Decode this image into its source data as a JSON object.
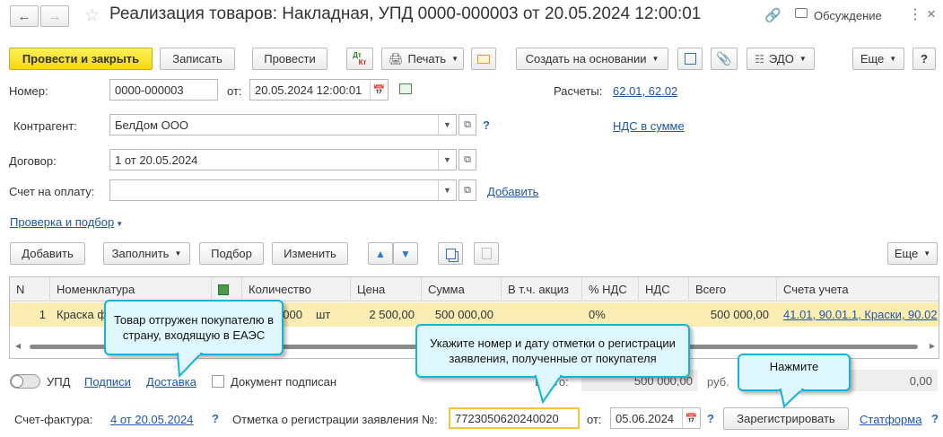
{
  "window": {
    "title": "Реализация товаров: Накладная, УПД 0000-000003 от 20.05.2024 12:00:01",
    "discussion": "Обсуждение"
  },
  "toolbar": {
    "post_close": "Провести и закрыть",
    "save": "Записать",
    "post": "Провести",
    "dtkt_top": "Дт",
    "dtkt_bottom": "Кт",
    "print": "Печать",
    "create_based": "Создать на основании",
    "edo": "ЭДО",
    "more": "Еще",
    "help": "?"
  },
  "header": {
    "number_label": "Номер:",
    "number_value": "0000-000003",
    "from_label": "от:",
    "date_value": "20.05.2024 12:00:01",
    "accounts_label": "Расчеты:",
    "accounts_value": "62.01, 62.02",
    "counterparty_label": "Контрагент:",
    "counterparty_value": "БелДом ООО",
    "vat_link": "НДС в сумме",
    "contract_label": "Договор:",
    "contract_value": "1 от 20.05.2024",
    "invoice_label": "Счет на оплату:",
    "invoice_value": "",
    "add_link": "Добавить",
    "check_link": "Проверка и подбор",
    "q": "?"
  },
  "table_toolbar": {
    "add": "Добавить",
    "fill": "Заполнить",
    "select": "Подбор",
    "change": "Изменить",
    "more": "Еще"
  },
  "table": {
    "headers": [
      "N",
      "Номенклатура",
      "Количество",
      "Цена",
      "Сумма",
      "В т.ч. акциз",
      "% НДС",
      "НДС",
      "Всего",
      "Счета учета"
    ],
    "row": {
      "n": "1",
      "item": "Краска ф",
      "qty": "000",
      "unit": "шт",
      "price": "2 500,00",
      "sum": "500 000,00",
      "excise": "",
      "vat_rate": "0%",
      "vat": "",
      "total": "500 000,00",
      "accounts": "41.01, 90.01.1, Краски, 90.02"
    }
  },
  "footer": {
    "upd": "УПД",
    "signatures": "Подписи",
    "delivery": "Доставка",
    "signed": "Документ подписан",
    "total_label": "Всего:",
    "total_value": "500 000,00",
    "currency": "руб.",
    "vat_value": "0,00",
    "invoice_label": "Счет-фактура:",
    "invoice_link": "4 от 20.05.2024",
    "reg_label": "Отметка о регистрации заявления №:",
    "reg_value": "7723050620240020",
    "reg_from": "от:",
    "reg_date": "05.06.2024",
    "register_btn": "Зарегистрировать",
    "statform": "Статформа"
  },
  "callouts": {
    "eaeu": "Товар отгружен покупателю в страну, входящую в ЕАЭС",
    "hint": "Укажите номер и дату отметки о регистрации заявления, полученные от покупателя",
    "press": "Нажмите"
  },
  "colors": {
    "primary_button": "#f6d70f",
    "link": "#1f55a8",
    "selected_row": "#fbedb4",
    "callout_border": "#15b3d8",
    "callout_bg": "#dff7ff",
    "highlight_field": "#f5c242"
  }
}
